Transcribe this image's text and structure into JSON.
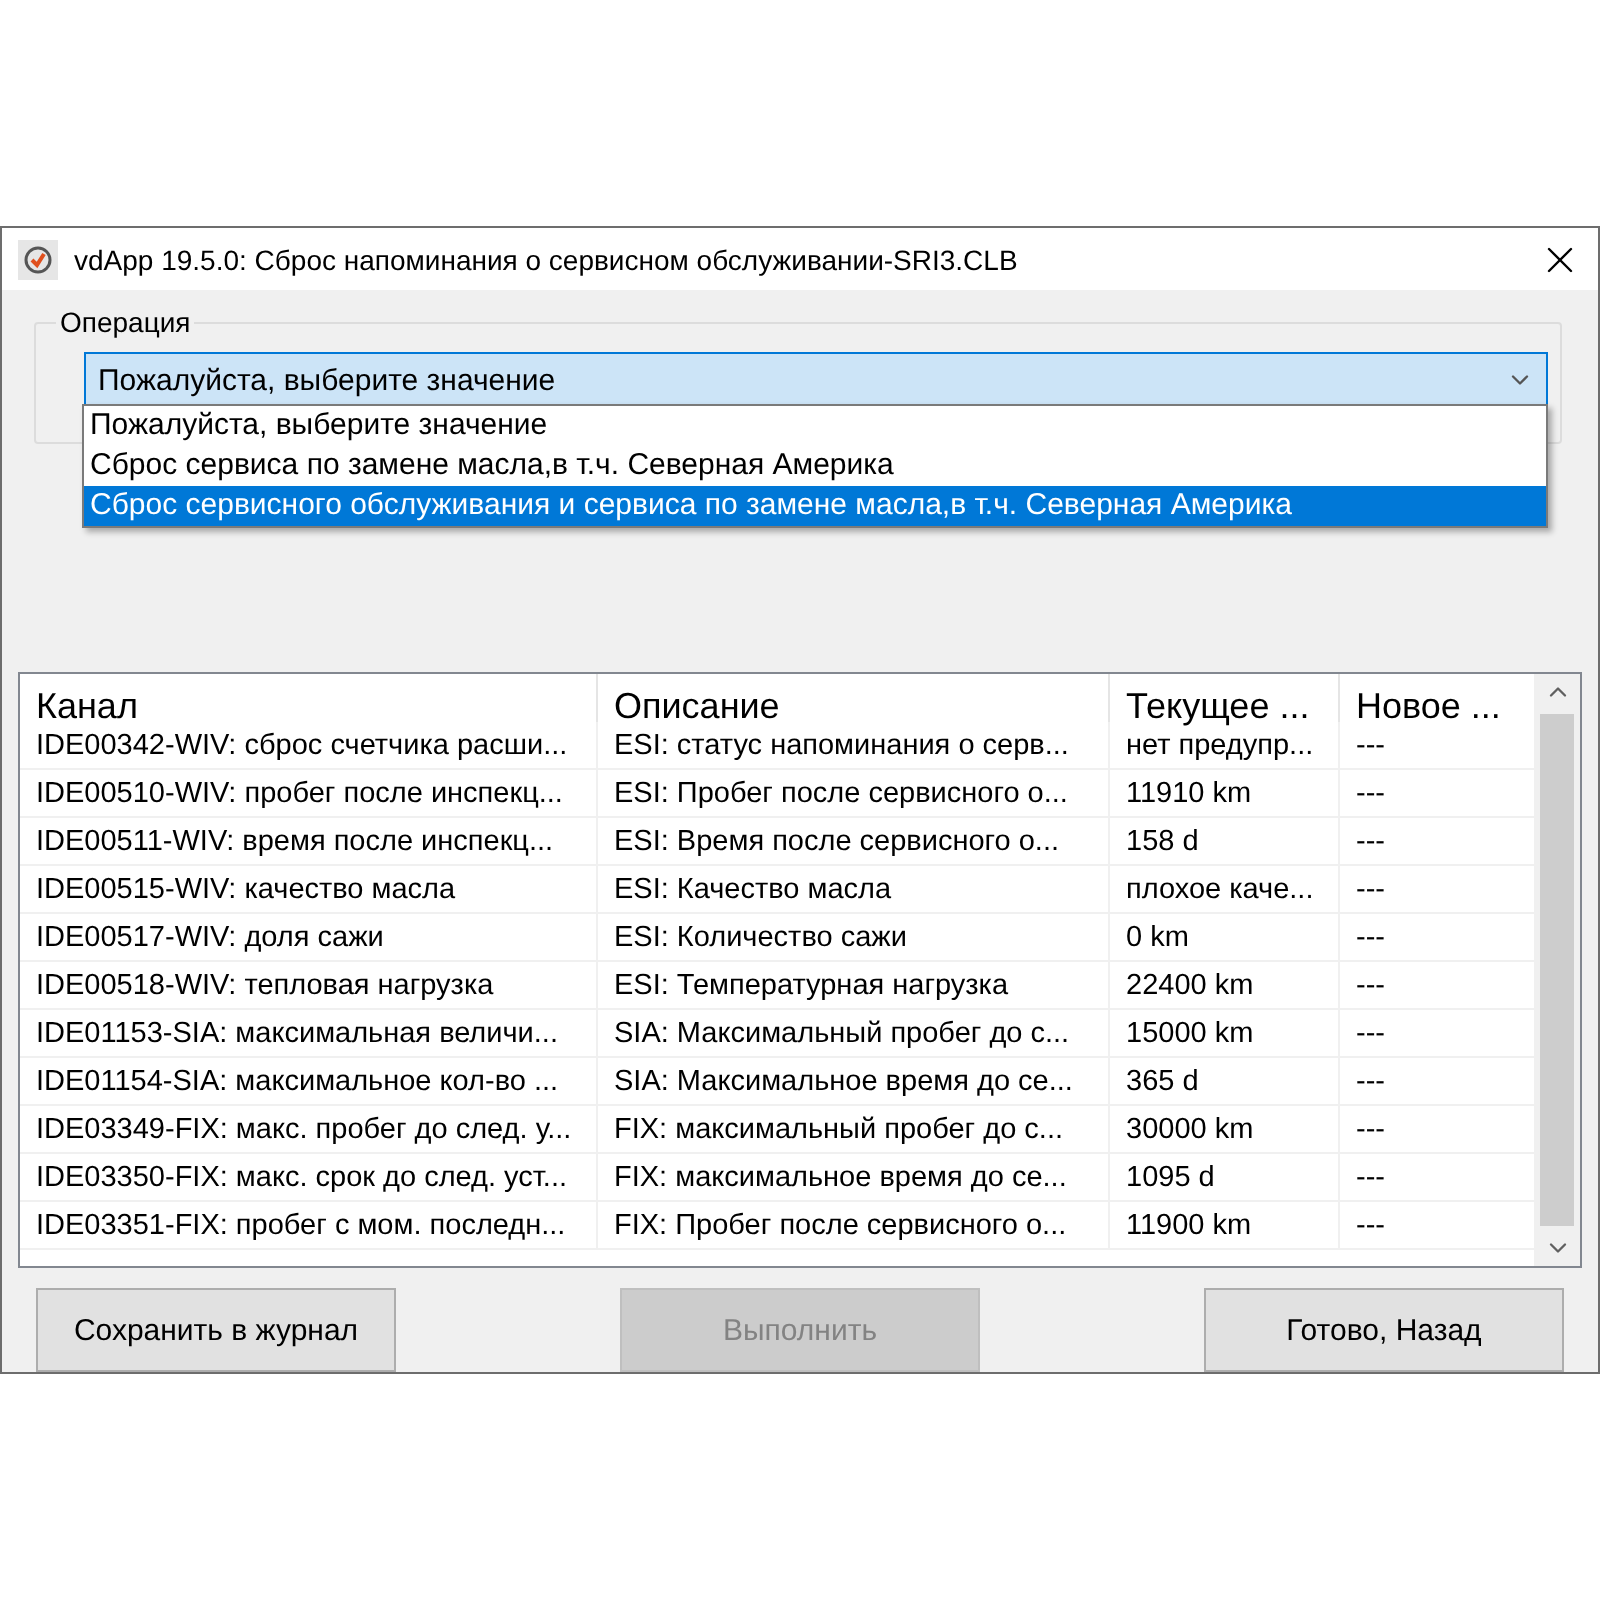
{
  "window": {
    "title": "vdApp 19.5.0:  Сброс напоминания о сервисном обслуживании-SRI3.CLB"
  },
  "operation": {
    "label": "Операция",
    "value": "Пожалуйста, выберите значение",
    "expanded": true,
    "options": [
      {
        "label": "Пожалуйста, выберите значение",
        "highlighted": false
      },
      {
        "label": "Сброс сервиса по замене масла,в т.ч. Северная Америка",
        "highlighted": false
      },
      {
        "label": "Сброс сервисного обслуживания и сервиса по замене масла,в т.ч. Северная Америка",
        "highlighted": true
      }
    ]
  },
  "table": {
    "columns": [
      "Канал",
      "Описание",
      "Текущее ...",
      "Новое ..."
    ],
    "rows": [
      [
        "IDE00342-WIV: сброс счетчика расши...",
        "ESI: статус напоминания о серв...",
        "нет предупр...",
        "---"
      ],
      [
        "IDE00510-WIV: пробег после инспекц...",
        "ESI: Пробег после сервисного о...",
        "11910 km",
        "---"
      ],
      [
        "IDE00511-WIV: время после инспекц...",
        "ESI: Время после сервисного о...",
        "158 d",
        "---"
      ],
      [
        "IDE00515-WIV: качество масла",
        "ESI: Качество масла",
        "плохое каче...",
        "---"
      ],
      [
        "IDE00517-WIV: доля сажи",
        "ESI: Количество сажи",
        "0 km",
        "---"
      ],
      [
        "IDE00518-WIV: тепловая нагрузка",
        "ESI: Температурная нагрузка",
        "22400 km",
        "---"
      ],
      [
        "IDE01153-SIA: максимальная величи...",
        "SIA: Максимальный пробег до с...",
        "15000 km",
        "---"
      ],
      [
        "IDE01154-SIA: максимальное кол-во ...",
        "SIA: Максимальное время до се...",
        "365 d",
        "---"
      ],
      [
        "IDE03349-FIX: макс. пробег до след. у...",
        "FIX: максимальный пробег до с...",
        "30000 km",
        "---"
      ],
      [
        "IDE03350-FIX: макс. срок до след. уст...",
        "FIX: максимальное время до се...",
        "1095 d",
        "---"
      ],
      [
        "IDE03351-FIX: пробег с мом. последн...",
        "FIX: Пробег после сервисного о...",
        "11900 km",
        "---"
      ]
    ]
  },
  "buttons": [
    {
      "label": "Сохранить в журнал",
      "disabled": false
    },
    {
      "label": "Выполнить",
      "disabled": true
    },
    {
      "label": "Готово, Назад",
      "disabled": false
    }
  ]
}
